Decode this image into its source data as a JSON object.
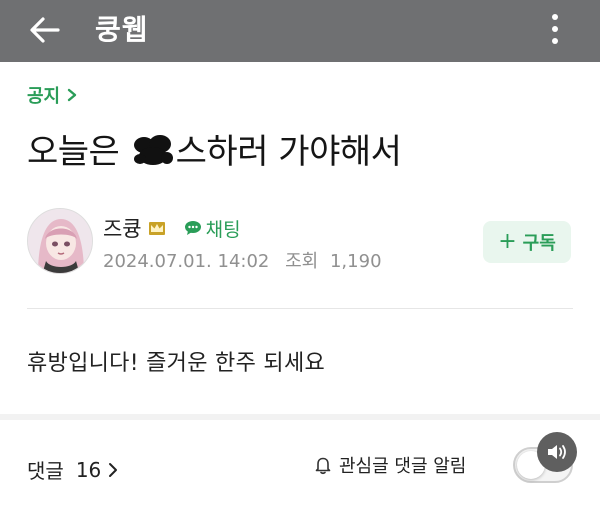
{
  "header": {
    "title": "쿵웹",
    "back_icon": "arrow-left-icon",
    "more_icon": "more-vertical-icon"
  },
  "board": {
    "label": "공지"
  },
  "post": {
    "title_before": "오늘은 ",
    "title_after": "스하러 가야해서",
    "censor_icon": "censor-blob",
    "author": "즈큥",
    "chat_label": "채팅",
    "date": "2024.07.01. 14:02",
    "views_label": "조회",
    "views_count": "1,190",
    "subscribe_label": "구독",
    "body": "휴방입니다! 즐거운 한주 되세요"
  },
  "footer": {
    "comments_label": "댓글",
    "comments_count": "16",
    "notify_label": "관심글 댓글 알림",
    "notify_on": false
  },
  "colors": {
    "header_bg": "#6f7072",
    "accent_green": "#2a9d58",
    "subscribe_bg": "#e9f6ee"
  }
}
